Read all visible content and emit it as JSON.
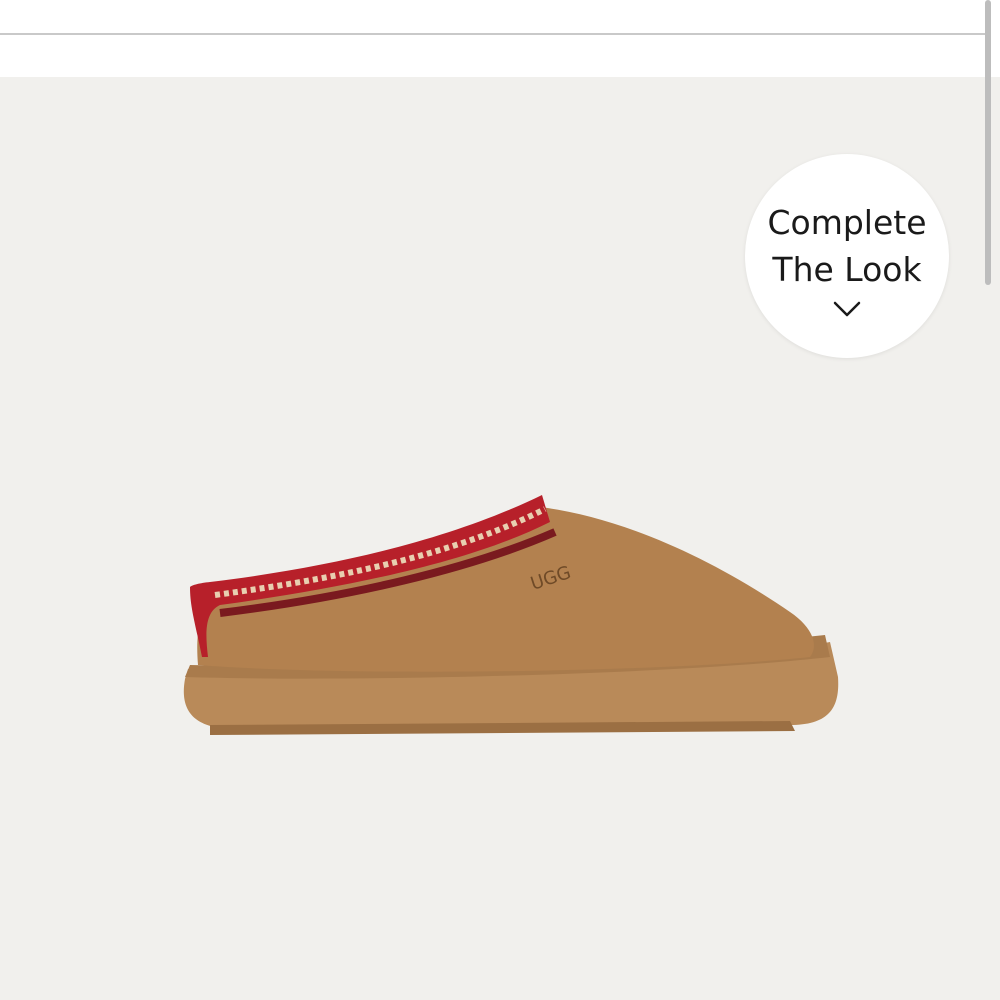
{
  "product": {
    "image_alt": "Chestnut platform slipper with red braided collar",
    "brand_mark": "UGG"
  },
  "complete_the_look": {
    "label": "Complete The Look",
    "icon": "chevron-down-icon"
  },
  "colors": {
    "image_background": "#f1f0ed",
    "shoe_upper": "#b3814f",
    "shoe_sole": "#b98a59",
    "braid_red": "#b7202a",
    "braid_cream": "#e8cfb0"
  }
}
